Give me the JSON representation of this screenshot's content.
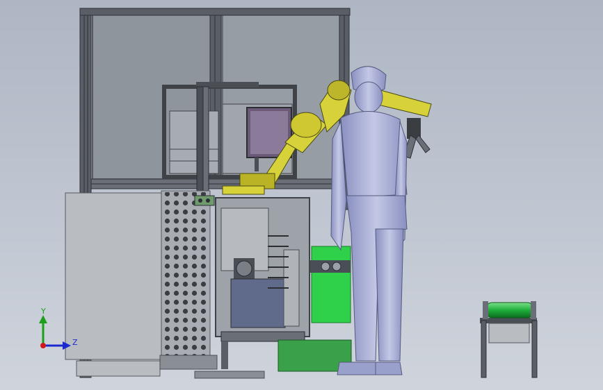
{
  "viewport": {
    "background_top": "#aeb6c4",
    "background_bottom": "#cfd4dc"
  },
  "triad": {
    "y_label": "Y",
    "z_label": "Z",
    "y_color": "#1aa01a",
    "z_color": "#1a2ad0",
    "origin_color": "#d01a1a"
  },
  "colors": {
    "frame": "#4a4e55",
    "panel_glass": "#8f959c",
    "robot": "#d8d23a",
    "green_panel": "#2fd04a",
    "conveyor_roller": "#1fae3a",
    "human": "#a8aed8",
    "screen": "#6a5a78",
    "cabinet": "#b9bcc1"
  }
}
